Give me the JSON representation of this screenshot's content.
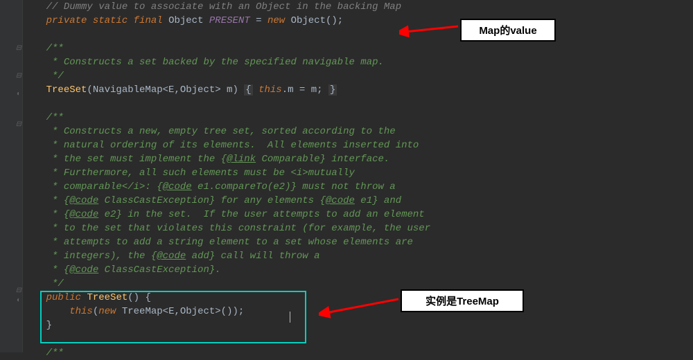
{
  "code": {
    "l1": "// Dummy value to associate with an Object in the backing Map",
    "l2_private": "private",
    "l2_static": "static",
    "l2_final": "final",
    "l2_type": "Object",
    "l2_name": "PRESENT",
    "l2_eq": " = ",
    "l2_new": "new",
    "l2_ctor": "Object",
    "l2_end": "();",
    "l3": "/**",
    "l4": " * Constructs a set backed by the specified navigable map.",
    "l5": " */",
    "l6_name": "TreeSet",
    "l6_sig": "(NavigableMap<E,Object> m) ",
    "l6_br1": "{",
    "l6_this": "this",
    "l6_body": ".m = m;",
    "l6_br2": "}",
    "l7": "/**",
    "l8": " * Constructs a new, empty tree set, sorted according to the",
    "l9": " * natural ordering of its elements.  All elements inserted into",
    "l10a": " * the set must implement the {",
    "l10link": "@link",
    "l10b": " Comparable} interface.",
    "l11": " * Furthermore, all such elements must be <i>mutually",
    "l12a": " * comparable</i>: {",
    "l12code": "@code",
    "l12b": " e1.compareTo(e2)} must not throw a",
    "l13a": " * {",
    "l13code": "@code",
    "l13b": " ClassCastException} for any elements {",
    "l13code2": "@code",
    "l13c": " e1} and",
    "l14a": " * {",
    "l14code": "@code",
    "l14b": " e2} in the set.  If the user attempts to add an element",
    "l15": " * to the set that violates this constraint (for example, the user",
    "l16": " * attempts to add a string element to a set whose elements are",
    "l17a": " * integers), the {",
    "l17code": "@code",
    "l17b": " add} call will throw a",
    "l18a": " * {",
    "l18code": "@code",
    "l18b": " ClassCastException}.",
    "l19": " */",
    "l20_public": "public",
    "l20_name": "TreeSet",
    "l20_sig": "() {",
    "l21_this": "this",
    "l21_paren": "(",
    "l21_new": "new",
    "l21_type": " TreeMap<E,Object>());",
    "l22": "}",
    "l23": "/**"
  },
  "annotations": {
    "map_value": "Map的value",
    "instance_treemap": "实例是TreeMap"
  },
  "colors": {
    "arrow": "#ff0000",
    "highlight": "#00d0c0"
  }
}
